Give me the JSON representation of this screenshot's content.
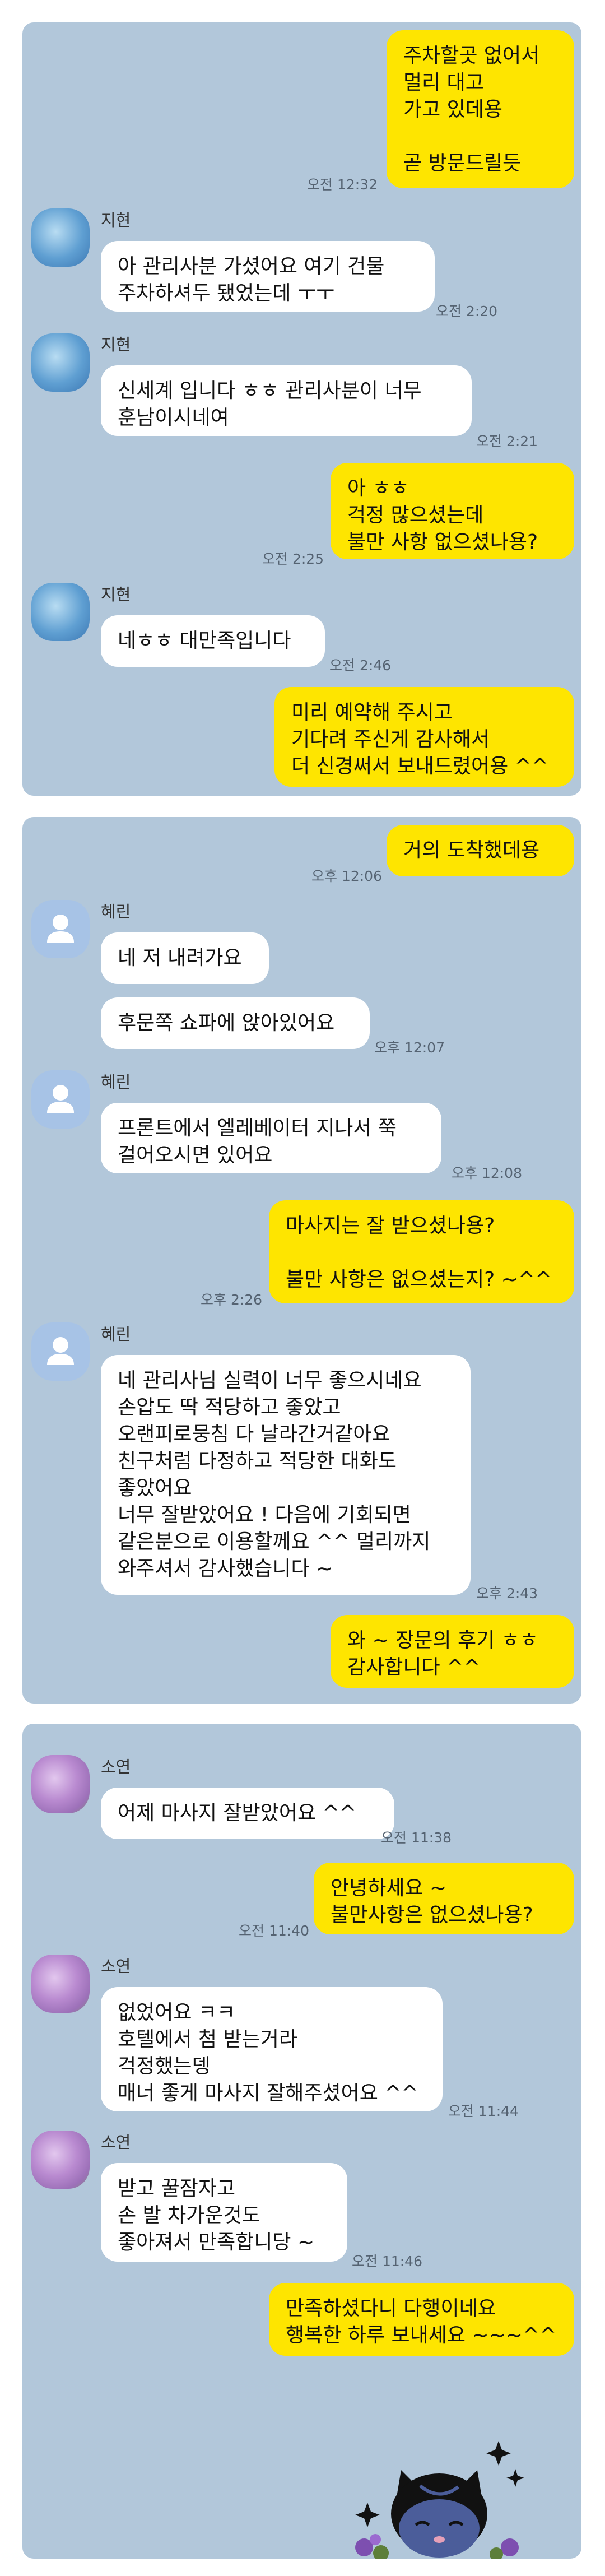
{
  "panel1": {
    "m1": {
      "text": "주차할곳 없어서\n멀리 대고\n가고 있데용\n\n곧 방문드릴듯",
      "time": "오전 12:32"
    },
    "sender": "지현",
    "m2": {
      "text": "아 관리사분 가셨어요 여기 건물\n주차하셔두 됐었는데 ㅜㅜ",
      "time": "오전 2:20"
    },
    "m3": {
      "text": "신세계 입니다 ㅎㅎ 관리사분이 너무\n훈남이시네여",
      "time": "오전 2:21"
    },
    "m4": {
      "text": "아 ㅎㅎ\n걱정 많으셨는데\n불만 사항 없으셨나용?",
      "time": "오전 2:25"
    },
    "m5": {
      "text": "네ㅎㅎ 대만족입니다",
      "time": "오전 2:46"
    },
    "m6": {
      "text": "미리 예약해 주시고\n기다려 주신게 감사해서\n더 신경써서 보내드렸어용 ^^"
    }
  },
  "panel2": {
    "m1": {
      "text": "거의 도착했데용",
      "time": "오후 12:06"
    },
    "sender": "혜린",
    "m2": {
      "text": "네 저 내려가요"
    },
    "m3": {
      "text": "후문쪽 쇼파에 앉아있어요",
      "time": "오후 12:07"
    },
    "m4": {
      "text": "프론트에서 엘레베이터 지나서 쭉\n걸어오시면 있어요",
      "time": "오후 12:08"
    },
    "m5": {
      "text": "마사지는 잘 받으셨나용?\n\n불만 사항은 없으셨는지? ~^^",
      "time": "오후 2:26"
    },
    "m6": {
      "text": "네 관리사님 실력이 너무 좋으시네요\n손압도 딱 적당하고 좋았고\n오랜피로뭉침 다 날라간거같아요\n친구처럼 다정하고 적당한 대화도\n좋았어요\n너무 잘받았어요 ! 다음에 기회되면\n같은분으로 이용할께요 ^^ 멀리까지\n와주셔서 감사했습니다 ~",
      "time": "오후 2:43"
    },
    "m7": {
      "text": "와 ~ 장문의 후기 ㅎㅎ\n감사합니다 ^^"
    }
  },
  "panel3": {
    "sender": "소연",
    "m1": {
      "text": "어제 마사지 잘받았어요 ^^",
      "time": "오전 11:38"
    },
    "m2": {
      "text": "안녕하세요 ~\n불만사항은 없으셨나용?",
      "time": "오전 11:40"
    },
    "m3": {
      "text": "없었어요 ㅋㅋ\n호텔에서 첨 받는거라\n걱정했는뎅\n매너 좋게 마사지 잘해주셨어요 ^^",
      "time": "오전 11:44"
    },
    "m4": {
      "text": "받고 꿀잠자고\n손 발 차가운것도\n좋아져서 만족합니당 ~",
      "time": "오전 11:46"
    },
    "m5": {
      "text": "만족하셨다니 다행이네요\n행복한 하루 보내세요 ~~~^^"
    }
  },
  "colors": {
    "chat_bg": "#b2c7da",
    "my_bubble": "#fee500",
    "their_bubble": "#ffffff"
  },
  "icons": {
    "default_avatar": "person-silhouette-icon",
    "sticker": "kakao-neo-cat-sticker-icon"
  }
}
